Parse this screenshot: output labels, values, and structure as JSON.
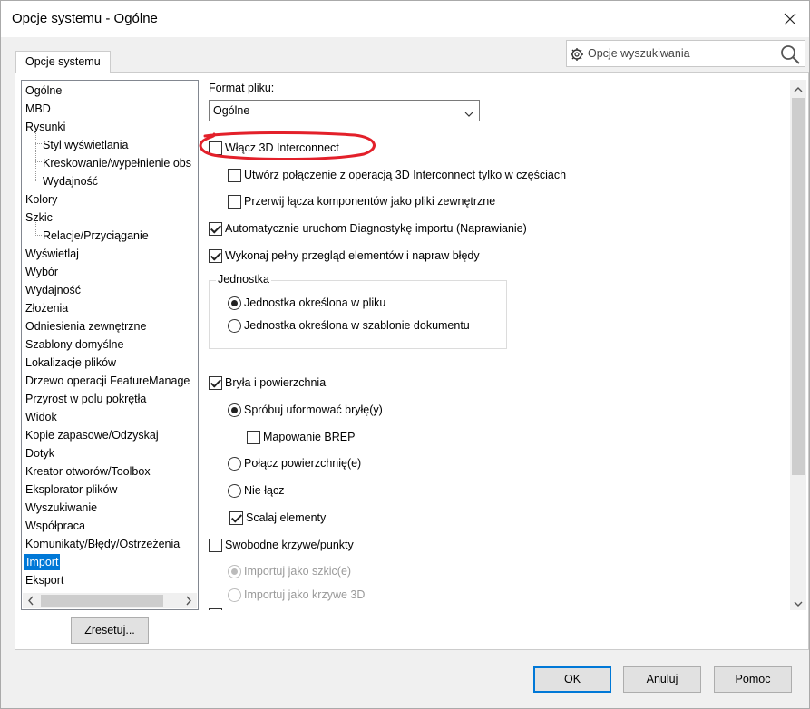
{
  "window": {
    "title": "Opcje systemu - Ogólne"
  },
  "tab": {
    "label": "Opcje systemu"
  },
  "search": {
    "placeholder": "Opcje wyszukiwania"
  },
  "tree": {
    "items": [
      {
        "label": "Ogólne",
        "level": 0
      },
      {
        "label": "MBD",
        "level": 0
      },
      {
        "label": "Rysunki",
        "level": 0
      },
      {
        "label": "Styl wyświetlania",
        "level": 1
      },
      {
        "label": "Kreskowanie/wypełnienie obs",
        "level": 1
      },
      {
        "label": "Wydajność",
        "level": 1
      },
      {
        "label": "Kolory",
        "level": 0
      },
      {
        "label": "Szkic",
        "level": 0
      },
      {
        "label": "Relacje/Przyciąganie",
        "level": 1
      },
      {
        "label": "Wyświetlaj",
        "level": 0
      },
      {
        "label": "Wybór",
        "level": 0
      },
      {
        "label": "Wydajność",
        "level": 0
      },
      {
        "label": "Złożenia",
        "level": 0
      },
      {
        "label": "Odniesienia zewnętrzne",
        "level": 0
      },
      {
        "label": "Szablony domyślne",
        "level": 0
      },
      {
        "label": "Lokalizacje plików",
        "level": 0
      },
      {
        "label": "Drzewo operacji FeatureManage",
        "level": 0
      },
      {
        "label": "Przyrost w polu pokrętła",
        "level": 0
      },
      {
        "label": "Widok",
        "level": 0
      },
      {
        "label": "Kopie zapasowe/Odzyskaj",
        "level": 0
      },
      {
        "label": "Dotyk",
        "level": 0
      },
      {
        "label": "Kreator otworów/Toolbox",
        "level": 0
      },
      {
        "label": "Eksplorator plików",
        "level": 0
      },
      {
        "label": "Wyszukiwanie",
        "level": 0
      },
      {
        "label": "Współpraca",
        "level": 0
      },
      {
        "label": "Komunikaty/Błędy/Ostrzeżenia",
        "level": 0
      },
      {
        "label": "Import",
        "level": 0,
        "selected": true
      },
      {
        "label": "Eksport",
        "level": 0
      }
    ],
    "reset_label": "Zresetuj..."
  },
  "content": {
    "format_label": "Format pliku:",
    "format_value": "Ogólne",
    "enable_3d_interconnect": {
      "label": "Włącz 3D Interconnect",
      "checked": false
    },
    "create_link_parts_only": {
      "label": "Utwórz połączenie z operacją 3D Interconnect tylko w częściach",
      "checked": false
    },
    "break_links_external": {
      "label": "Przerwij łącza komponentów jako pliki zewnętrzne",
      "checked": false
    },
    "auto_import_diagnostics": {
      "label": "Automatycznie uruchom Diagnostykę importu (Naprawianie)",
      "checked": true
    },
    "full_check": {
      "label": "Wykonaj pełny przegląd elementów i napraw błędy",
      "checked": true
    },
    "unit_group_title": "Jednostka",
    "unit_from_file": {
      "label": "Jednostka określona w pliku",
      "selected": true
    },
    "unit_from_template": {
      "label": "Jednostka określona w szablonie dokumentu",
      "selected": false
    },
    "solid_surface": {
      "label": "Bryła i powierzchnia",
      "checked": true
    },
    "try_form_solid": {
      "label": "Spróbuj uformować bryłę(y)",
      "selected": true
    },
    "brep_mapping": {
      "label": "Mapowanie BREP",
      "checked": false
    },
    "knit_surfaces": {
      "label": "Połącz powierzchnię(e)",
      "selected": false
    },
    "do_not_knit": {
      "label": "Nie łącz",
      "selected": false
    },
    "merge_entities": {
      "label": "Scalaj elementy",
      "checked": true
    },
    "free_curves": {
      "label": "Swobodne krzywe/punkty",
      "checked": false
    },
    "import_as_sketch": {
      "label": "Importuj jako szkic(e)",
      "selected": true
    },
    "import_as_3d_curves": {
      "label": "Importuj jako krzywe 3D",
      "selected": false
    }
  },
  "buttons": {
    "ok": "OK",
    "cancel": "Anuluj",
    "help": "Pomoc"
  },
  "colors": {
    "accent": "#0078d7",
    "annotation": "#e3202a"
  }
}
